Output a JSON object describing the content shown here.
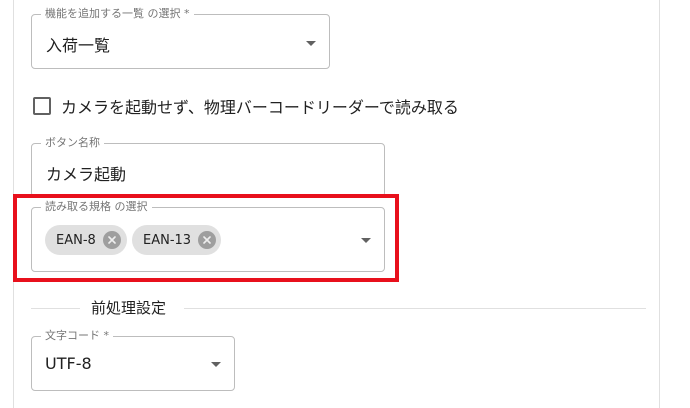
{
  "feature_list_select": {
    "label": "機能を追加する一覧 の選択 *",
    "value": "入荷一覧"
  },
  "camera_checkbox": {
    "label": "カメラを起動せず、物理バーコードリーダーで読み取る",
    "checked": false
  },
  "button_name": {
    "label": "ボタン名称",
    "value": "カメラ起動"
  },
  "format_select": {
    "label": "読み取る規格 の選択",
    "chips": [
      {
        "label": "EAN-8"
      },
      {
        "label": "EAN-13"
      }
    ]
  },
  "preprocess_section": {
    "title": "前処理設定"
  },
  "charset_select": {
    "label": "文字コード *",
    "value": "UTF-8"
  },
  "colors": {
    "highlight": "#e8101c",
    "chip_background": "#e0e0e0"
  }
}
